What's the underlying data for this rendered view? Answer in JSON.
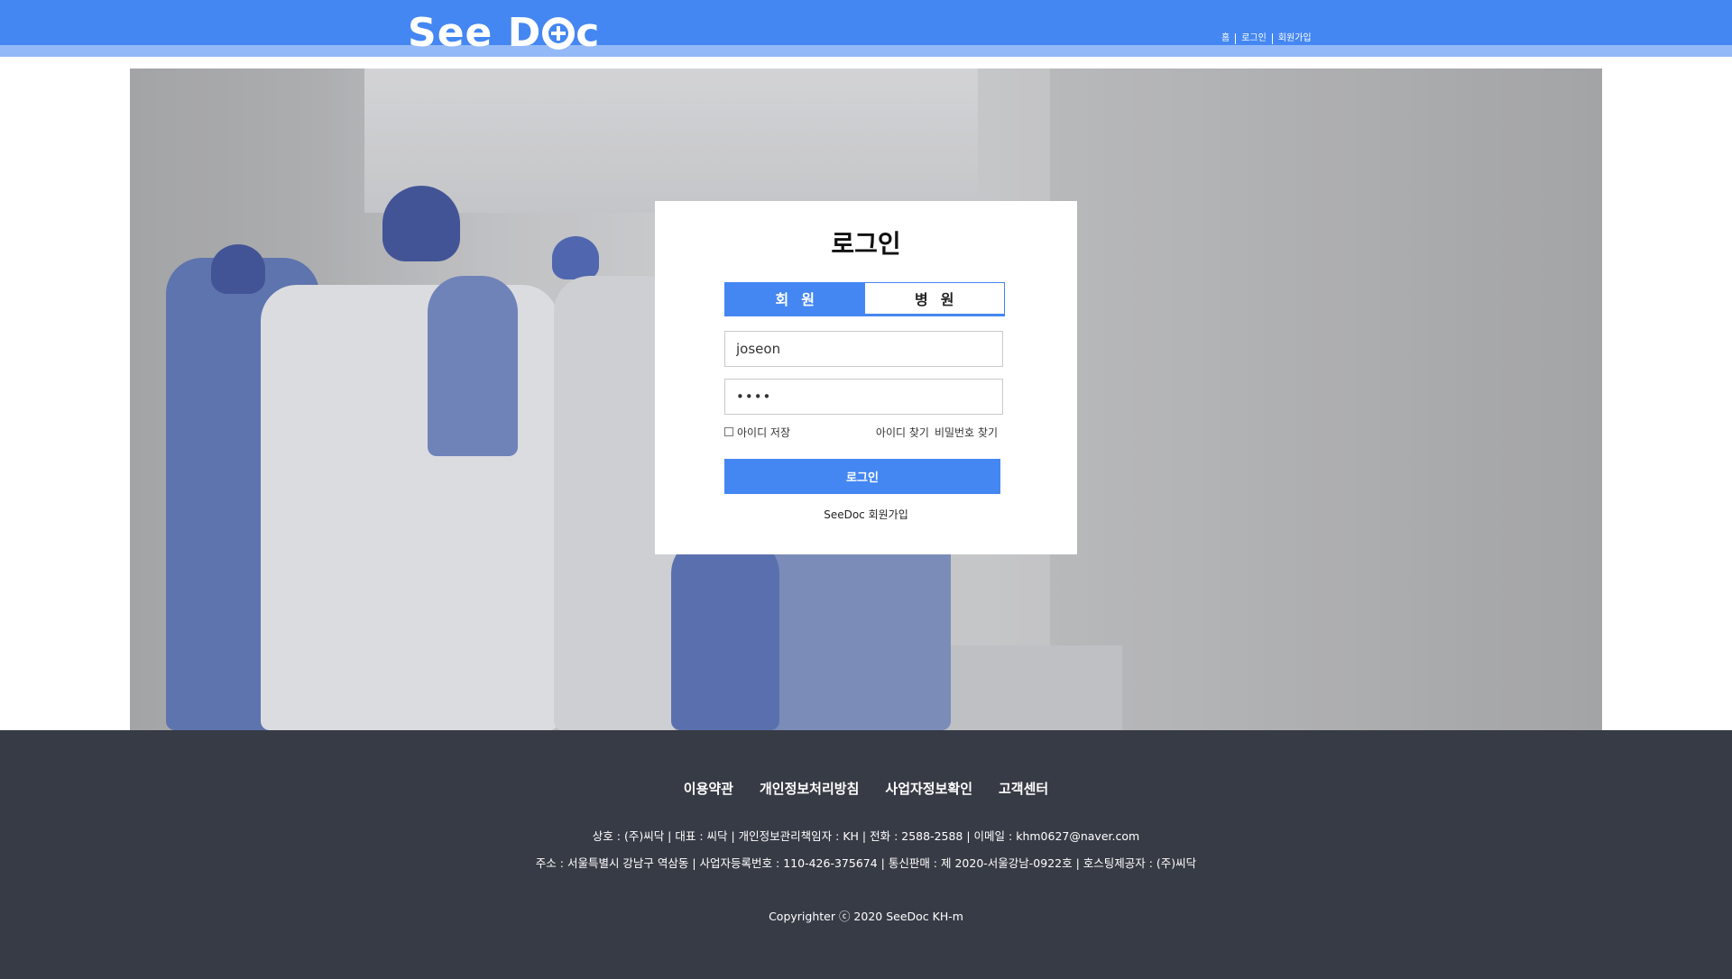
{
  "header": {
    "logo_text_left": "See D",
    "logo_text_right": "c",
    "nav": [
      {
        "label": "홈"
      },
      {
        "label": "로그인"
      },
      {
        "label": "회원가입"
      }
    ],
    "accent_color": "#4487f2"
  },
  "login": {
    "title": "로그인",
    "tabs": [
      {
        "label": "회원",
        "active": true
      },
      {
        "label": "병원",
        "active": false
      }
    ],
    "id_value": "joseon",
    "password_mask": "••••",
    "remember_label": "아이디 저장",
    "remember_checked": false,
    "find_id_label": "아이디 찾기",
    "find_pw_label": "비밀번호 찾기",
    "submit_label": "로그인",
    "signup_label": "SeeDoc 회원가입"
  },
  "footer": {
    "links": [
      {
        "label": "이용약관"
      },
      {
        "label": "개인정보처리방침"
      },
      {
        "label": "사업자정보확인"
      },
      {
        "label": "고객센터"
      }
    ],
    "info_line1": "상호 : (주)씨닥 | 대표 : 씨닥 | 개인정보관리책임자 : KH | 전화 : 2588-2588 | 이메일 : khm0627@naver.com",
    "info_line2": "주소 : 서울특별시 강남구 역삼동 | 사업자등록번호 : 110-426-375674 | 통신판매 : 제 2020-서울강남-0922호 | 호스팅제공자 : (주)씨닥",
    "copyright": "Copyrighter ⓒ 2020 SeeDoc KH-m"
  }
}
